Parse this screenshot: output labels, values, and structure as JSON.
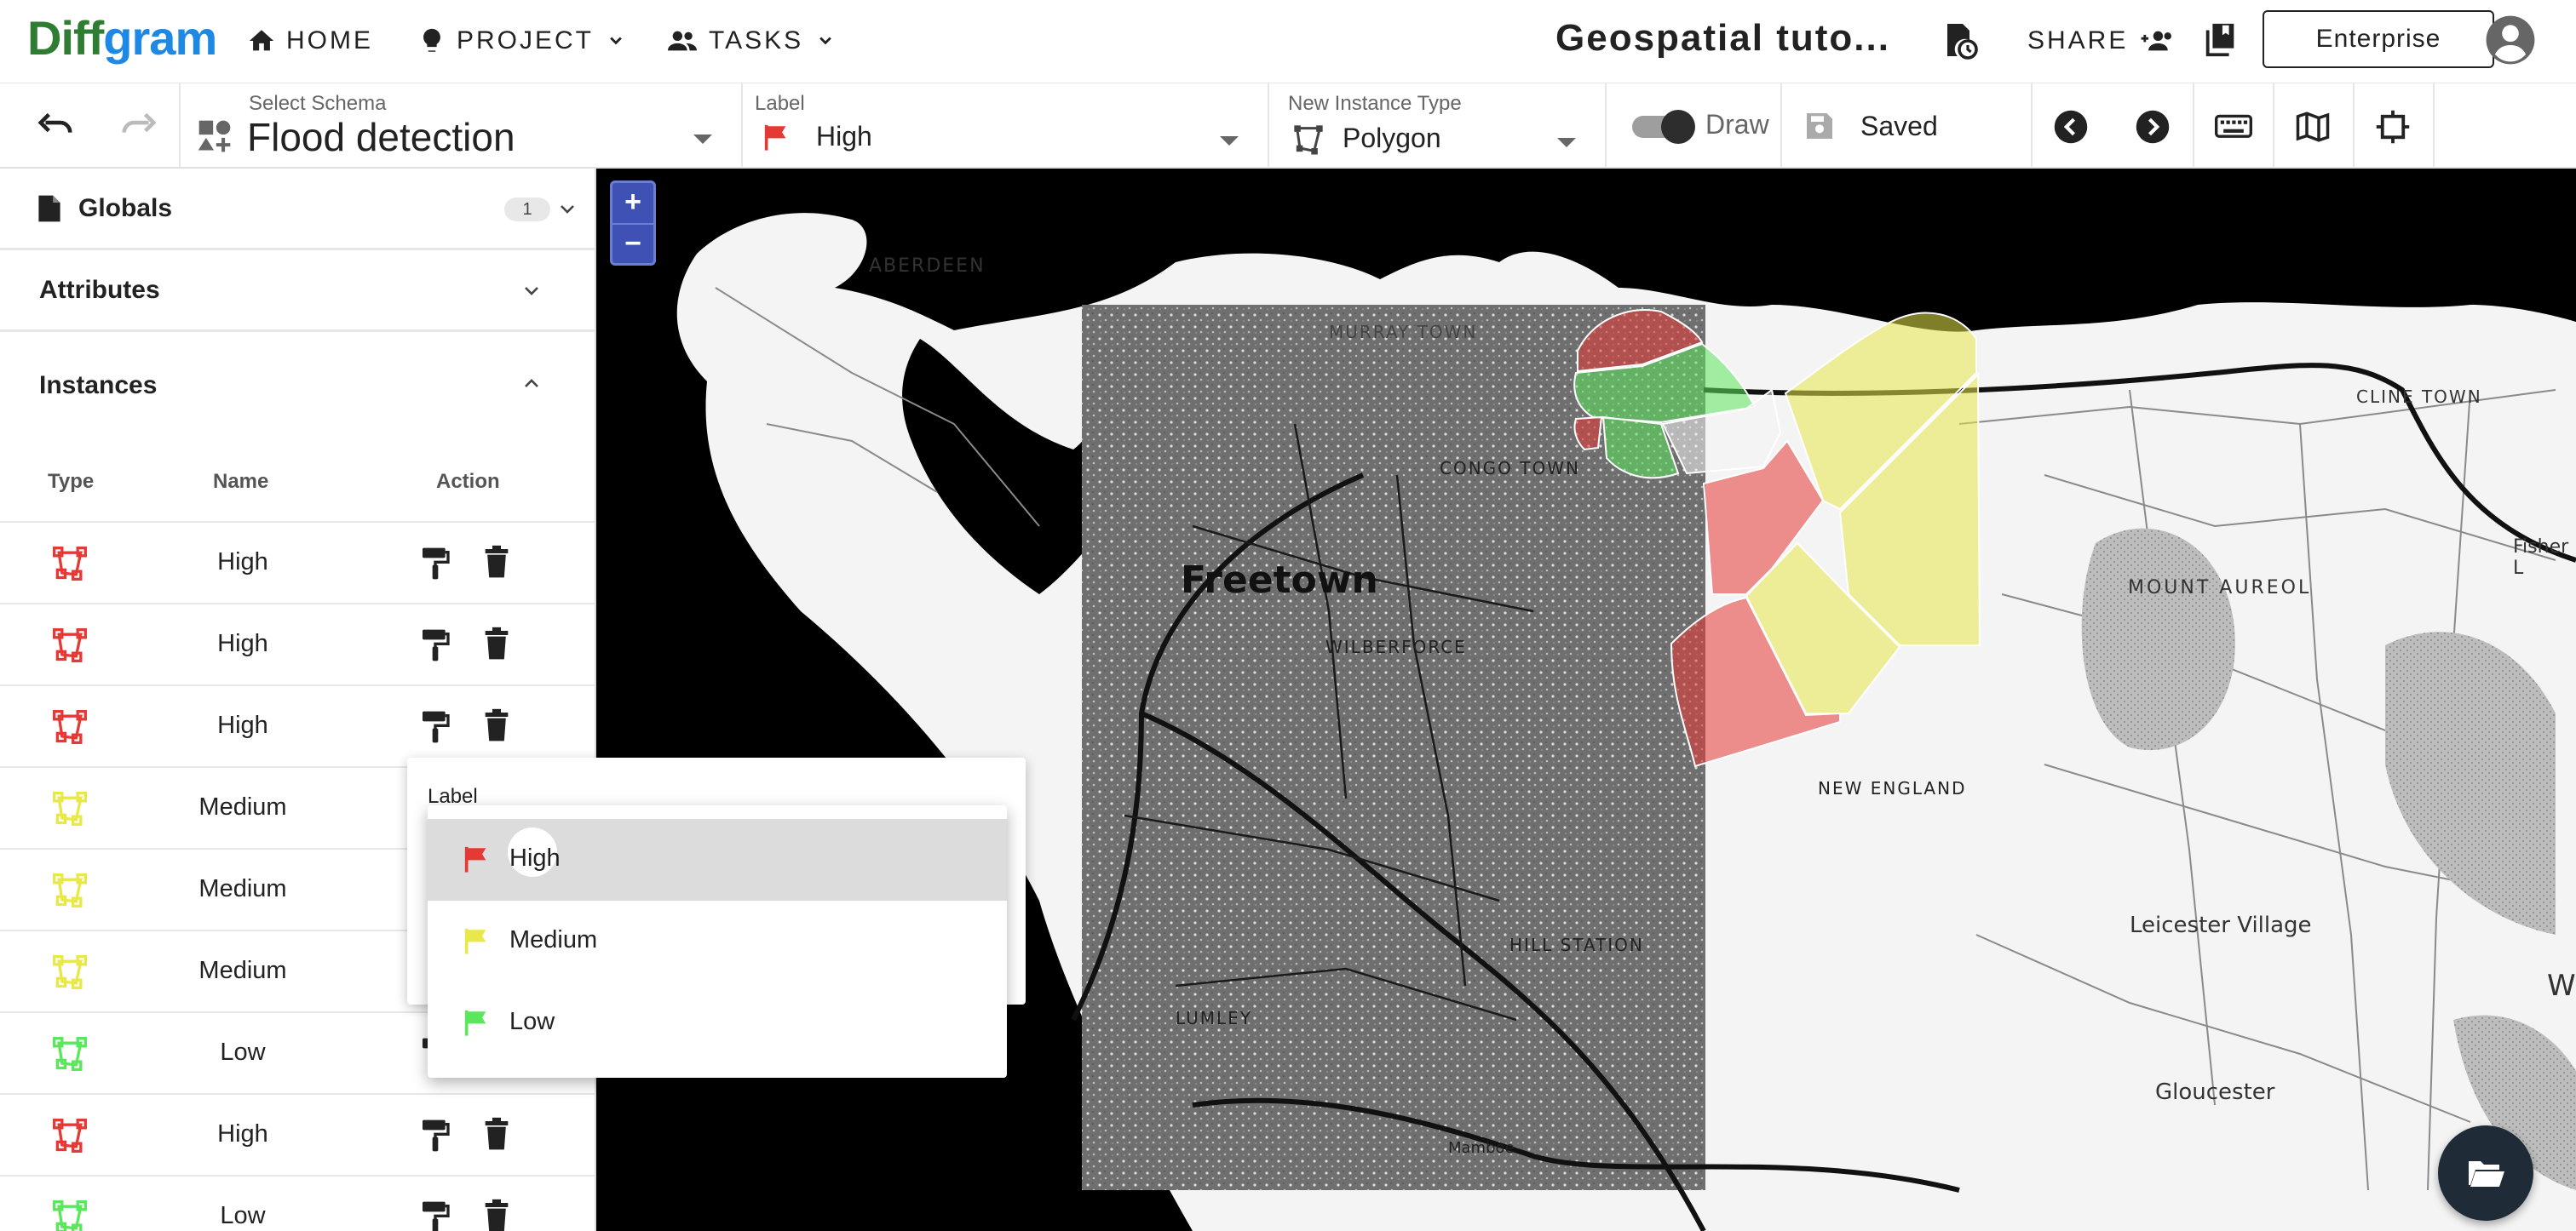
{
  "brand": {
    "part1": "Diff",
    "part2": "gram"
  },
  "nav": {
    "home": "HOME",
    "project": "PROJECT",
    "tasks": "TASKS"
  },
  "header": {
    "title": "Geospatial tuto...",
    "share": "SHARE",
    "enterprise": "Enterprise"
  },
  "toolbar": {
    "schema_label": "Select Schema",
    "schema_value": "Flood detection",
    "label_label": "Label",
    "label_value": "High",
    "instance_type_label": "New Instance Type",
    "instance_type_value": "Polygon",
    "draw_label": "Draw",
    "saved_label": "Saved"
  },
  "sidebar": {
    "globals_title": "Globals",
    "globals_count": "1",
    "attributes_title": "Attributes",
    "instances_title": "Instances",
    "columns": {
      "type": "Type",
      "name": "Name",
      "action": "Action"
    },
    "instances": [
      {
        "name": "High",
        "level": "high"
      },
      {
        "name": "High",
        "level": "high"
      },
      {
        "name": "High",
        "level": "high"
      },
      {
        "name": "Medium",
        "level": "medium"
      },
      {
        "name": "Medium",
        "level": "medium"
      },
      {
        "name": "Medium",
        "level": "medium"
      },
      {
        "name": "Low",
        "level": "low"
      },
      {
        "name": "High",
        "level": "high"
      },
      {
        "name": "Low",
        "level": "low"
      }
    ]
  },
  "label_dropdown": {
    "label": "Label",
    "options": [
      {
        "name": "High",
        "color": "#e53935",
        "selected": true
      },
      {
        "name": "Medium",
        "color": "#e8e84a",
        "selected": false
      },
      {
        "name": "Low",
        "color": "#5be65b",
        "selected": false
      }
    ]
  },
  "map": {
    "labels": {
      "aberdeen": "ABERDEEN",
      "murray_town": "MURRAY TOWN",
      "congo_town": "CONGO TOWN",
      "freetown": "Freetown",
      "wilberforce": "WILBERFORCE",
      "hill_station": "HILL STATION",
      "new_england": "NEW ENGLAND",
      "lumley": "LUMLEY",
      "mount_aureol": "MOUNT AUREOL",
      "cline_town": "CLINE TOWN",
      "fisher_lane": "Fisher L",
      "leicester_village": "Leicester Village",
      "gloucester": "Gloucester",
      "w": "W",
      "mamboe": "Mamboe"
    },
    "zoom_in": "+",
    "zoom_out": "−"
  },
  "colors": {
    "high": "#e53935",
    "medium": "#e8e84a",
    "low": "#5be65b",
    "accent": "#3f51b5"
  }
}
